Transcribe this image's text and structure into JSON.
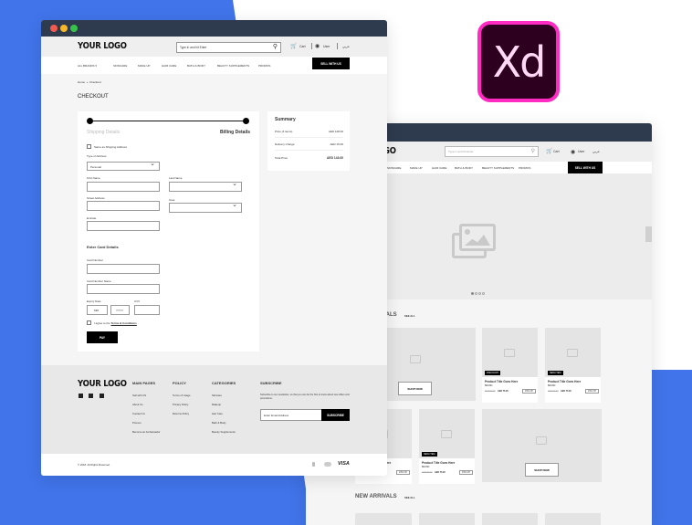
{
  "colors": {
    "background_blue": "#4174ea",
    "titlebar": "#2e3b4e",
    "xd_border": "#ff2bc2",
    "xd_bg": "#2e001f",
    "xd_text": "#ffd9f5"
  },
  "xd_logo": {
    "text": "Xd"
  },
  "header": {
    "logo": "YOUR LOGO",
    "search_placeholder": "Type in and hit Enter",
    "cart": "Cart",
    "user": "User",
    "language": "عربي"
  },
  "nav": {
    "items": [
      "ALL BRANDS",
      "SKINCARE",
      "MAKE UP",
      "HAIR CARE",
      "BATH & BODY",
      "BEAUTY SUPPLEMENTS",
      "PROMOS"
    ],
    "sell": "SELL WITH US"
  },
  "checkout": {
    "breadcrumb": [
      "Home",
      "»",
      "Checkout"
    ],
    "title": "CHECKOUT",
    "steps": [
      "Shipping Details",
      "Billing Details"
    ],
    "same_as_shipping": "Same as Shipping Address",
    "type_of_address": "Type of Address",
    "type_value": "Personal",
    "first_name": "First Name",
    "last_name": "Last Name",
    "street": "Street Address",
    "area": "Area",
    "emirate": "Emirate",
    "card_heading": "Enter Card Details",
    "card_number": "Card Number",
    "card_name": "Card Number Name",
    "expiry": "Expiry Date",
    "mm": "MM",
    "yyyy": "YYYY",
    "cvv": "CVV",
    "agree": "I agree to the",
    "terms": "Terms & Conditions",
    "pay": "PAY"
  },
  "summary": {
    "title": "Summary",
    "rows": [
      {
        "label": "Price (4 items)",
        "value": "AED 128.00"
      },
      {
        "label": "Delivery Charge",
        "value": "AED 15.00"
      },
      {
        "label": "Total Price",
        "value": "AED 143.00"
      }
    ]
  },
  "footer": {
    "logo": "YOUR LOGO",
    "main_pages": {
      "title": "MAIN PAGES",
      "links": [
        "Sell with US",
        "About Us",
        "Contact Us",
        "Promos",
        "Become an Ambassador"
      ]
    },
    "policy": {
      "title": "POLICY",
      "links": [
        "Terms of Usage",
        "Privacy Policy",
        "Returns Policy"
      ]
    },
    "categories": {
      "title": "CATEGORIES",
      "links": [
        "Skincare",
        "Makeup",
        "Hair Care",
        "Bath & Body",
        "Beauty Supplements"
      ]
    },
    "subscribe": {
      "title": "SUBSCRIBE",
      "text": "Subscribe to our newsletter, so that you can be the first to know about new offers and promotions.",
      "placeholder": "Enter Email Address",
      "button": "SUBSCRIBE"
    },
    "copyright": "© 2018. All Rights Reserved.",
    "visa": "VISA"
  },
  "home": {
    "section1": "NEW ARRIVALS",
    "see_all": "SEE ALL",
    "section2": "NEW ARRIVALS",
    "shop_now": "SHOP NOW",
    "product": {
      "title": "Product Title Goes Here",
      "brand": "BRAND",
      "old_price": "AED 90.00",
      "price": "AED 75.00",
      "discount": "15% Off"
    },
    "badges": [
      "DISCOUNT",
      "NEW ITEM",
      "NEW ITEM"
    ]
  }
}
